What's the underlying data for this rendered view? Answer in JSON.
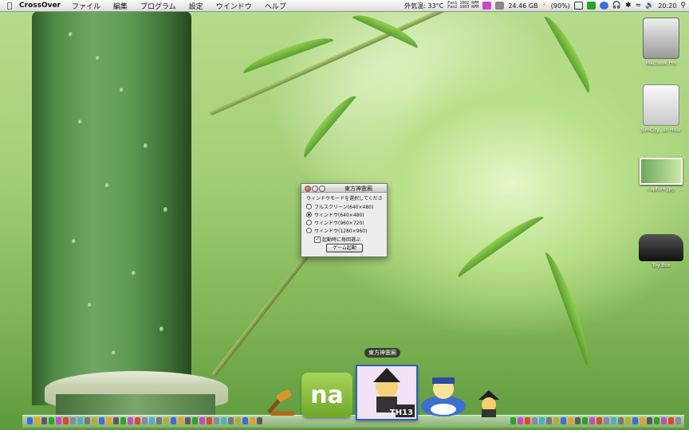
{
  "menubar": {
    "apple_icon": "apple-icon",
    "app_name": "CrossOver",
    "menus": [
      "ファイル",
      "編集",
      "プログラム",
      "設定",
      "ウインドウ",
      "ヘルプ"
    ],
    "temperature": "外気温: 33°C",
    "fan_rpm_1": "Fan1 1002 RPM",
    "fan_rpm_2": "Fan2 1003 RPM",
    "disk_free": "24.46 GB",
    "battery": "(90%)",
    "clock": "20:20"
  },
  "desktop_icons": [
    {
      "label": "Macbook Pro",
      "icon": "hard-drive-icon"
    },
    {
      "label": "SimCity...sh Hour",
      "icon": "disk-icon"
    },
    {
      "label": "capture.jpg",
      "icon": "image-file-icon"
    },
    {
      "label": "Toy Box",
      "icon": "car-icon"
    }
  ],
  "dialog": {
    "title": "東方神霊廟",
    "prompt": "ウィンドウモードを選択してください",
    "options": [
      {
        "label": "フルスクリーン(640×480)",
        "selected": false
      },
      {
        "label": "ウィンドウ(640×480)",
        "selected": true
      },
      {
        "label": "ウィンドウ(960×720)",
        "selected": false
      },
      {
        "label": "ウィンドウ(1280×960)",
        "selected": false
      }
    ],
    "checkbox_label": "起動時に毎回選ぶ",
    "checkbox_checked": true,
    "start_button": "ゲーム起動"
  },
  "dock": {
    "tooltip": "東方神霊廟",
    "big_icons": [
      "gavel-icon",
      "na-app-icon",
      "th13-game-icon",
      "alice-icon",
      "marisa-icon"
    ],
    "na_label": "na",
    "th13_badge": "TH13"
  }
}
